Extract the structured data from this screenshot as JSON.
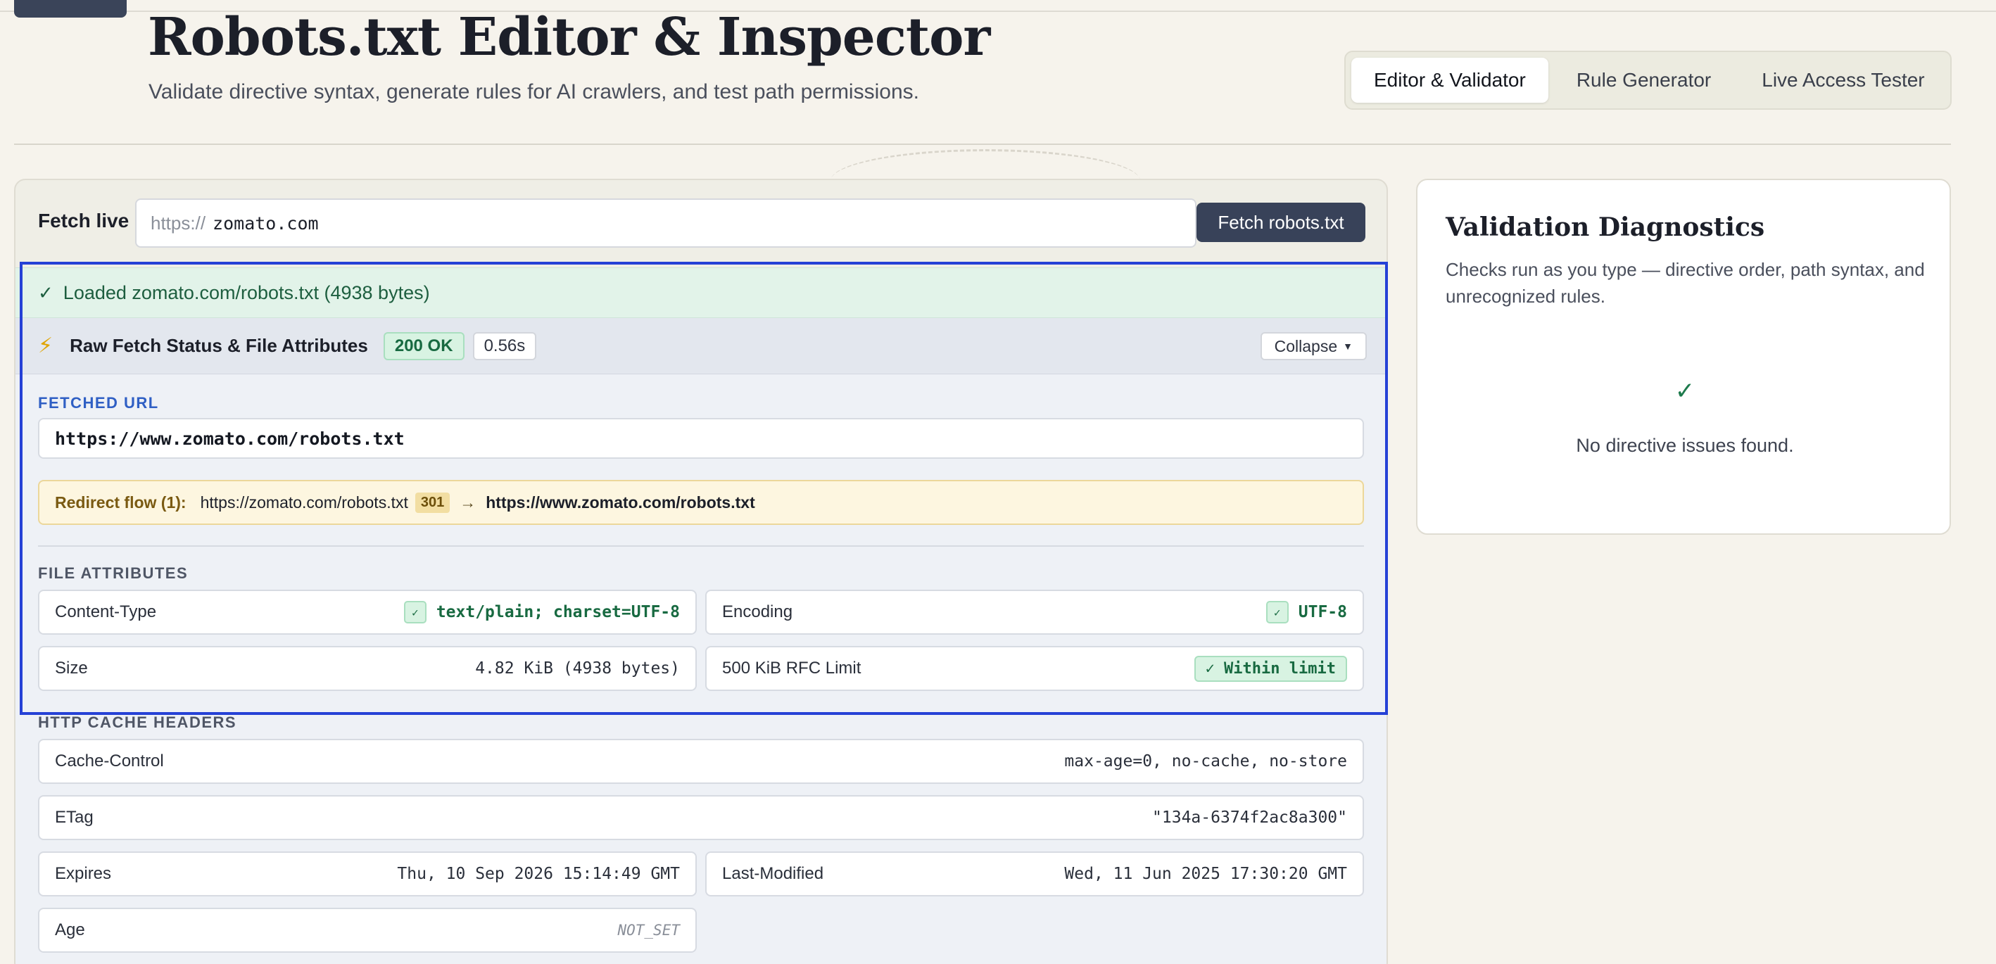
{
  "header": {
    "title": "Robots.txt Editor & Inspector",
    "subtitle": "Validate directive syntax, generate rules for AI crawlers, and test path permissions.",
    "tabs": [
      {
        "label": "Editor & Validator",
        "active": true
      },
      {
        "label": "Rule Generator",
        "active": false
      },
      {
        "label": "Live Access Tester",
        "active": false
      }
    ]
  },
  "fetch": {
    "label": "Fetch live",
    "prefix": "https://",
    "value": "zomato.com",
    "button": "Fetch robots.txt"
  },
  "loaded": {
    "icon": "check-icon",
    "message": "Loaded zomato.com/robots.txt (4938 bytes)"
  },
  "status": {
    "icon": "lightning-icon",
    "title": "Raw Fetch Status & File Attributes",
    "code": "200 OK",
    "time": "0.56s",
    "collapse": "Collapse"
  },
  "fetched": {
    "label": "FETCHED URL",
    "url": "https://www.zomato.com/robots.txt"
  },
  "redirect": {
    "label": "Redirect flow (1):",
    "from": "https://zomato.com/robots.txt",
    "code": "301",
    "to": "https://www.zomato.com/robots.txt"
  },
  "file_attributes": {
    "label": "FILE ATTRIBUTES",
    "content_type": {
      "key": "Content-Type",
      "value": "text/plain; charset=UTF-8"
    },
    "encoding": {
      "key": "Encoding",
      "value": "UTF-8"
    },
    "size": {
      "key": "Size",
      "value": "4.82 KiB (4938 bytes)"
    },
    "limit": {
      "key": "500 KiB RFC Limit",
      "value": "✓ Within limit"
    }
  },
  "cache_headers": {
    "label": "HTTP CACHE HEADERS",
    "cache_control": {
      "key": "Cache-Control",
      "value": "max-age=0, no-cache, no-store"
    },
    "etag": {
      "key": "ETag",
      "value": "\"134a-6374f2ac8a300\""
    },
    "expires": {
      "key": "Expires",
      "value": "Thu, 10 Sep 2026 15:14:49 GMT"
    },
    "last_modified": {
      "key": "Last-Modified",
      "value": "Wed, 11 Jun 2025 17:30:20 GMT"
    },
    "age": {
      "key": "Age",
      "value": "NOT_SET"
    }
  },
  "diagnostics": {
    "title": "Validation Diagnostics",
    "description": "Checks run as you type — directive order, path syntax, and unrecognized rules.",
    "icon": "check-icon",
    "message": "No directive issues found."
  },
  "colors": {
    "accent_dark": "#384259",
    "success": "#186a41",
    "highlight": "#2541d6"
  }
}
